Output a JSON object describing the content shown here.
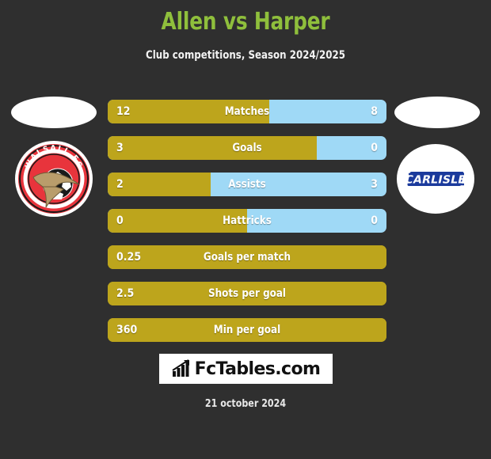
{
  "header": {
    "title": "Allen vs Harper",
    "subtitle": "Club competitions, Season 2024/2025",
    "title_color": "#8fbf3c"
  },
  "teams": {
    "home": {
      "crest_name": "Walsall FC",
      "crest_text": "WALSALL FC",
      "crest_colors": {
        "primary": "#e8343c",
        "secondary": "#ffffff",
        "bird": "#b99d6b"
      }
    },
    "away": {
      "crest_name": "Carlisle",
      "crest_text": "CARLISLE",
      "crest_colors": {
        "primary": "#1b3a9c",
        "secondary": "#ffffff"
      }
    }
  },
  "colors": {
    "background": "#2f2f2f",
    "home_bar": "#bda51c",
    "away_bar": "#9fd9f6",
    "value_text": "#ffffff"
  },
  "chart_data": {
    "type": "bar",
    "title": "Allen vs Harper",
    "subtitle": "Club competitions, Season 2024/2025",
    "orientation": "horizontal-diverging",
    "series": [
      {
        "name": "Allen",
        "color": "#bda51c"
      },
      {
        "name": "Harper",
        "color": "#9fd9f6"
      }
    ],
    "rows": [
      {
        "label": "Matches",
        "left": "12",
        "right": "8",
        "left_pct": 58,
        "dual": true
      },
      {
        "label": "Goals",
        "left": "3",
        "right": "0",
        "left_pct": 75,
        "dual": true
      },
      {
        "label": "Assists",
        "left": "2",
        "right": "3",
        "left_pct": 37,
        "dual": true
      },
      {
        "label": "Hattricks",
        "left": "0",
        "right": "0",
        "left_pct": 50,
        "dual": true
      },
      {
        "label": "Goals per match",
        "left": "0.25",
        "right": "",
        "left_pct": 100,
        "dual": false
      },
      {
        "label": "Shots per goal",
        "left": "2.5",
        "right": "",
        "left_pct": 100,
        "dual": false
      },
      {
        "label": "Min per goal",
        "left": "360",
        "right": "",
        "left_pct": 100,
        "dual": false
      }
    ]
  },
  "footer": {
    "brand": "FcTables.com",
    "brand_icon": "bar-chart-icon",
    "date": "21 october 2024"
  }
}
